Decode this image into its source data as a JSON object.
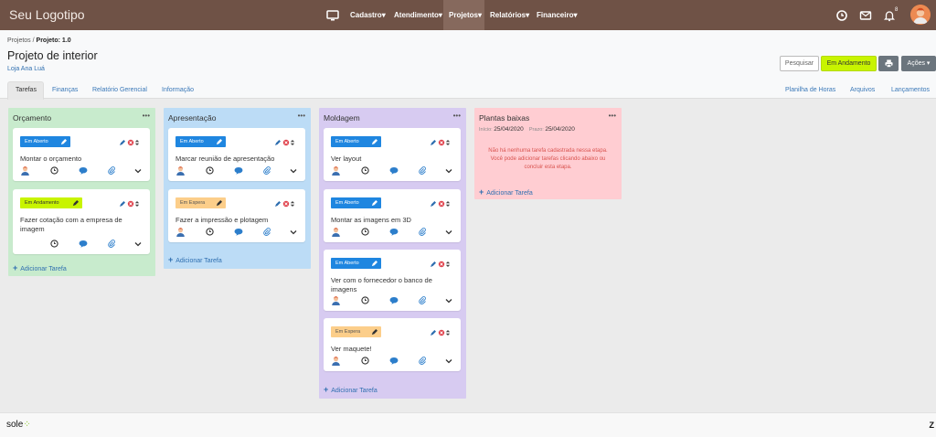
{
  "navbar": {
    "brand": "Seu Logotipo",
    "menu": [
      {
        "label": "Cadastro",
        "caret": "▾"
      },
      {
        "label": "Atendimento",
        "caret": "▾"
      },
      {
        "label": "Projetos",
        "caret": "▾"
      },
      {
        "label": "Relatórios",
        "caret": "▾"
      },
      {
        "label": "Financeiro",
        "caret": "▾"
      }
    ],
    "active_menu": "Projetos",
    "bell_count": "8",
    "icons": [
      "monitor-icon",
      "clock-icon",
      "mail-icon",
      "bell-icon"
    ],
    "colors": {
      "bar": "#6f5246",
      "active": "#86695d"
    }
  },
  "header": {
    "breadcrumb_parent": "Projetos",
    "breadcrumb_sep": " / ",
    "breadcrumb_current": "Projeto: 1.0",
    "title": "Projeto de interior",
    "client": "Loja Ana Luá",
    "buttons": {
      "search": "Pesquisar",
      "status": "Em Andamento",
      "print_icon": "printer-icon",
      "actions": "Ações ▾"
    }
  },
  "tabs": {
    "left": [
      "Tarefas",
      "Finanças",
      "Relatório Gerencial",
      "Informação"
    ],
    "right": [
      "Planilha de Horas",
      "Arquivos",
      "Lançamentos"
    ],
    "active": "Tarefas"
  },
  "board": {
    "add_task_label": "Adicionar Tarefa",
    "menu_dots": "•••",
    "columns": [
      {
        "title": "Orçamento",
        "color": "#c8ebcd",
        "cards": [
          {
            "status": "Em Aberto",
            "status_color": "#1f86e0",
            "title": "Montar o orçamento"
          },
          {
            "status": "Em Andamento",
            "status_color": "#c8f400",
            "title": "Fazer cotação com a empresa de imagem"
          }
        ]
      },
      {
        "title": "Apresentação",
        "color": "#bcdcf6",
        "cards": [
          {
            "status": "Em Aberto",
            "status_color": "#1f86e0",
            "title": "Marcar reunião de apresentação"
          },
          {
            "status": "Em Espera",
            "status_color": "#fcce8a",
            "title": "Fazer a impressão e plotagem"
          }
        ]
      },
      {
        "title": "Moldagem",
        "color": "#d7cbf1",
        "cards": [
          {
            "status": "Em Aberto",
            "status_color": "#1f86e0",
            "title": "Ver layout"
          },
          {
            "status": "Em Aberto",
            "status_color": "#1f86e0",
            "title": "Montar as imagens em 3D"
          },
          {
            "status": "Em Aberto",
            "status_color": "#1f86e0",
            "title": "Ver com o fornecedor o banco de imagens"
          },
          {
            "status": "Em Espera",
            "status_color": "#fcce8a",
            "title": "Ver maquete!"
          }
        ]
      },
      {
        "title": "Plantas baixas",
        "color": "#ffcdd2",
        "start_label": "Início:",
        "start_date": "25/04/2020",
        "due_label": "Prazo:",
        "due_date": "25/04/2020",
        "empty_line1": "Não há nenhuma tarefa cadastrada nessa etapa.",
        "empty_line2": "Você pode adicionar tarefas clicando abaixo ou",
        "empty_line3": "concluir esta etapa."
      }
    ]
  },
  "footer": {
    "logo": "sole",
    "right": "Z"
  }
}
